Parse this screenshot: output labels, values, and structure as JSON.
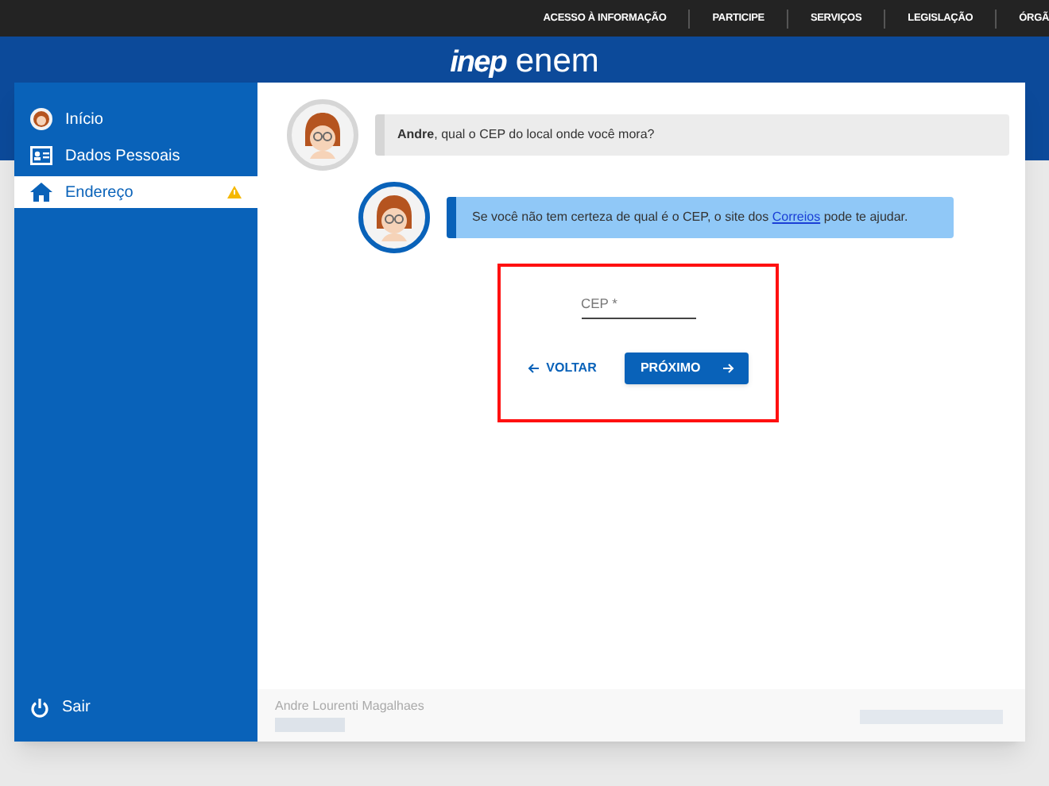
{
  "top_links": [
    "ACESSO À INFORMAÇÃO",
    "PARTICIPE",
    "SERVIÇOS",
    "LEGISLAÇÃO",
    "ÓRGÃ"
  ],
  "logo": {
    "brand": "inep",
    "product": "enem"
  },
  "sidebar": {
    "items": [
      {
        "kind": "avatar",
        "label": "Início",
        "selected": false,
        "warning": false
      },
      {
        "kind": "card",
        "label": "Dados Pessoais",
        "selected": false,
        "warning": false
      },
      {
        "kind": "home",
        "label": "Endereço",
        "selected": true,
        "warning": true
      }
    ],
    "logout": "Sair"
  },
  "messages": [
    {
      "kind": "question",
      "text": "**Andre**, qual o CEP do local onde você mora?"
    },
    {
      "kind": "hint",
      "before": "Se você não tem certeza de qual é o CEP, o site dos ",
      "link": "Correios",
      "after": " pode te ajudar."
    }
  ],
  "form": {
    "field_label": "CEP *",
    "back": "VOLTAR",
    "next": "PRÓXIMO"
  },
  "footer": {
    "user": "Andre Lourenti Magalhaes"
  }
}
